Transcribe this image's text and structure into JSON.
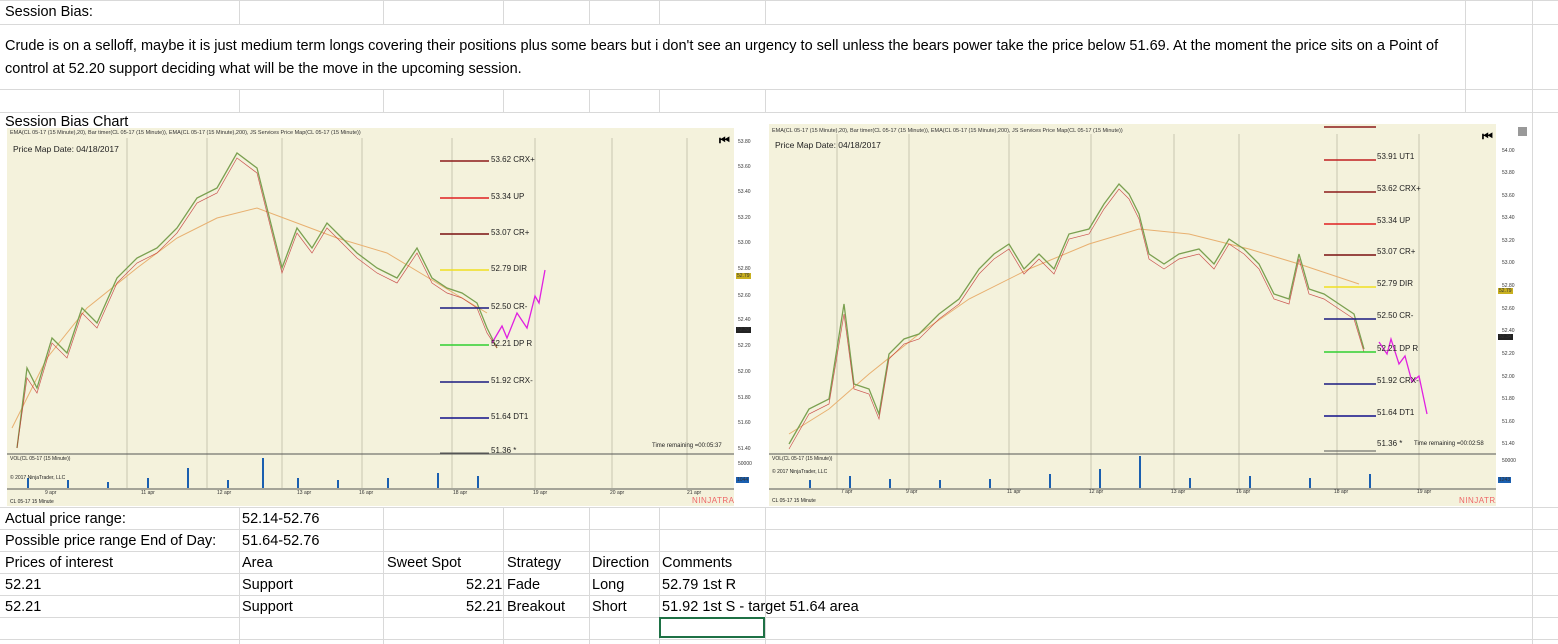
{
  "title": "Session Bias:",
  "paragraph": "Crude is on a selloff, maybe it is just medium term longs covering their positions plus some bears but i don't see an urgency to sell unless the bears power take the price below 51.69. At the moment the price sits on a Point of control at 52.20 support deciding what will be the move in the upcoming session.",
  "chart_title": "Session Bias Chart",
  "chart_left": {
    "header": "EMA(CL 05-17 (15 Minute),20), Bar timer(CL 05-17 (15 Minute)), EMA(CL 05-17 (15 Minute),200), JS Services Price Map(CL 05-17 (15 Minute))",
    "price_map": "Price Map Date: 04/18/2017",
    "levels": [
      {
        "label": "53.62 CRX+",
        "color": "#8b1a1a"
      },
      {
        "label": "53.34 UP",
        "color": "#e02020"
      },
      {
        "label": "53.07 CR+",
        "color": "#7a1010"
      },
      {
        "label": "52.79 DIR",
        "color": "#f0e020"
      },
      {
        "label": "52.50 CR-",
        "color": "#1a1a80"
      },
      {
        "label": "52.21 DP R",
        "color": "#30d030"
      },
      {
        "label": "51.92 CRX-",
        "color": "#1a1a80"
      },
      {
        "label": "51.64 DT1",
        "color": "#10108a"
      },
      {
        "label": "51.36 *",
        "color": "#555"
      }
    ],
    "time_remaining": "Time remaining =00:05:37",
    "vol": "VOL(CL 05-17 (15 Minute))",
    "copyright": "© 2017 NinjaTrader, LLC",
    "instrument": "CL 05-17 15 Minute",
    "axis": [
      "53.80",
      "53.60",
      "53.40",
      "53.20",
      "53.00",
      "52.80",
      "52.60",
      "52.40",
      "52.20",
      "52.00",
      "51.80",
      "51.60",
      "51.40"
    ],
    "tag1": "52.79",
    "tag2": "52.32",
    "vol_axis": "50000",
    "vol_tag": "1044",
    "dates": [
      "9 apr",
      "11 apr",
      "12 apr",
      "13 apr",
      "16 apr",
      "18 apr",
      "19 apr",
      "20 apr",
      "21 apr"
    ],
    "brand": "NINJATRADER"
  },
  "chart_right": {
    "header": "EMA(CL 05-17 (15 Minute),20), Bar timer(CL 05-17 (15 Minute)), EMA(CL 05-17 (15 Minute),200), JS Services Price Map(CL 05-17 (15 Minute))",
    "price_map": "Price Map Date: 04/18/2017",
    "levels": [
      {
        "label": "53.91 UT1",
        "color": "#c02020"
      },
      {
        "label": "53.62 CRX+",
        "color": "#8b1a1a"
      },
      {
        "label": "53.34 UP",
        "color": "#e02020"
      },
      {
        "label": "53.07 CR+",
        "color": "#7a1010"
      },
      {
        "label": "52.79 DIR",
        "color": "#f0e020"
      },
      {
        "label": "52.50 CR-",
        "color": "#1a1a80"
      },
      {
        "label": "52.21 DP R",
        "color": "#30d030"
      },
      {
        "label": "51.92 CRX-",
        "color": "#1a1a80"
      },
      {
        "label": "51.64 DT1",
        "color": "#10108a"
      },
      {
        "label": "51.36 *",
        "color": "#555"
      }
    ],
    "time_remaining": "Time remaining =00:02:58",
    "vol": "VOL(CL 05-17 (15 Minute))",
    "copyright": "© 2017 NinjaTrader, LLC",
    "instrument": "CL 05-17 15 Minute",
    "axis": [
      "54.00",
      "53.80",
      "53.60",
      "53.40",
      "53.20",
      "53.00",
      "52.80",
      "52.60",
      "52.40",
      "52.20",
      "52.00",
      "51.80",
      "51.60",
      "51.40"
    ],
    "tag1": "52.79",
    "tag2": "52.34",
    "vol_axis": "50000",
    "vol_tag": "1243",
    "dates": [
      "7 apr",
      "9 apr",
      "11 apr",
      "12 apr",
      "13 apr",
      "16 apr",
      "18 apr",
      "19 apr"
    ],
    "brand": "NINJATRADER"
  },
  "rows": {
    "actual_label": "Actual price range:",
    "actual_value": "52.14-52.76",
    "possible_label": "Possible price range End of Day:",
    "possible_value": "51.64-52.76",
    "headers": {
      "prices": "Prices of interest",
      "area": "Area",
      "sweet": "Sweet Spot",
      "strategy": "Strategy",
      "direction": "Direction",
      "comments": "Comments"
    },
    "data": [
      {
        "price": "52.21",
        "area": "Support",
        "sweet": "52.21",
        "strategy": "Fade",
        "direction": "Long",
        "comments": "52.79 1st R"
      },
      {
        "price": "52.21",
        "area": "Support",
        "sweet": "52.21",
        "strategy": "Breakout",
        "direction": "Short",
        "comments": "51.92 1st S - target 51.64 area"
      }
    ]
  }
}
